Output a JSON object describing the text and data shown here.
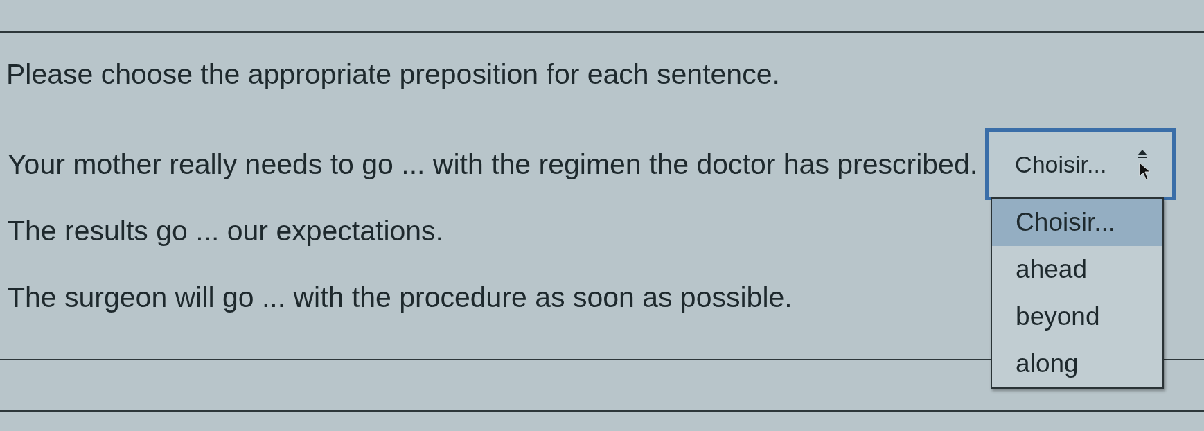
{
  "instruction": "Please choose the appropriate preposition for each sentence.",
  "questions": [
    {
      "sentence": "Your mother really needs to go ... with the regimen the doctor has prescribed.",
      "select": {
        "value": "Choisir...",
        "expanded": true,
        "options": [
          {
            "label": "Choisir...",
            "selected": true
          },
          {
            "label": "ahead",
            "selected": false
          },
          {
            "label": "beyond",
            "selected": false
          },
          {
            "label": "along",
            "selected": false
          }
        ]
      }
    },
    {
      "sentence": "The results go ... our expectations."
    },
    {
      "sentence": "The surgeon will go ... with the procedure as soon as possible."
    }
  ]
}
